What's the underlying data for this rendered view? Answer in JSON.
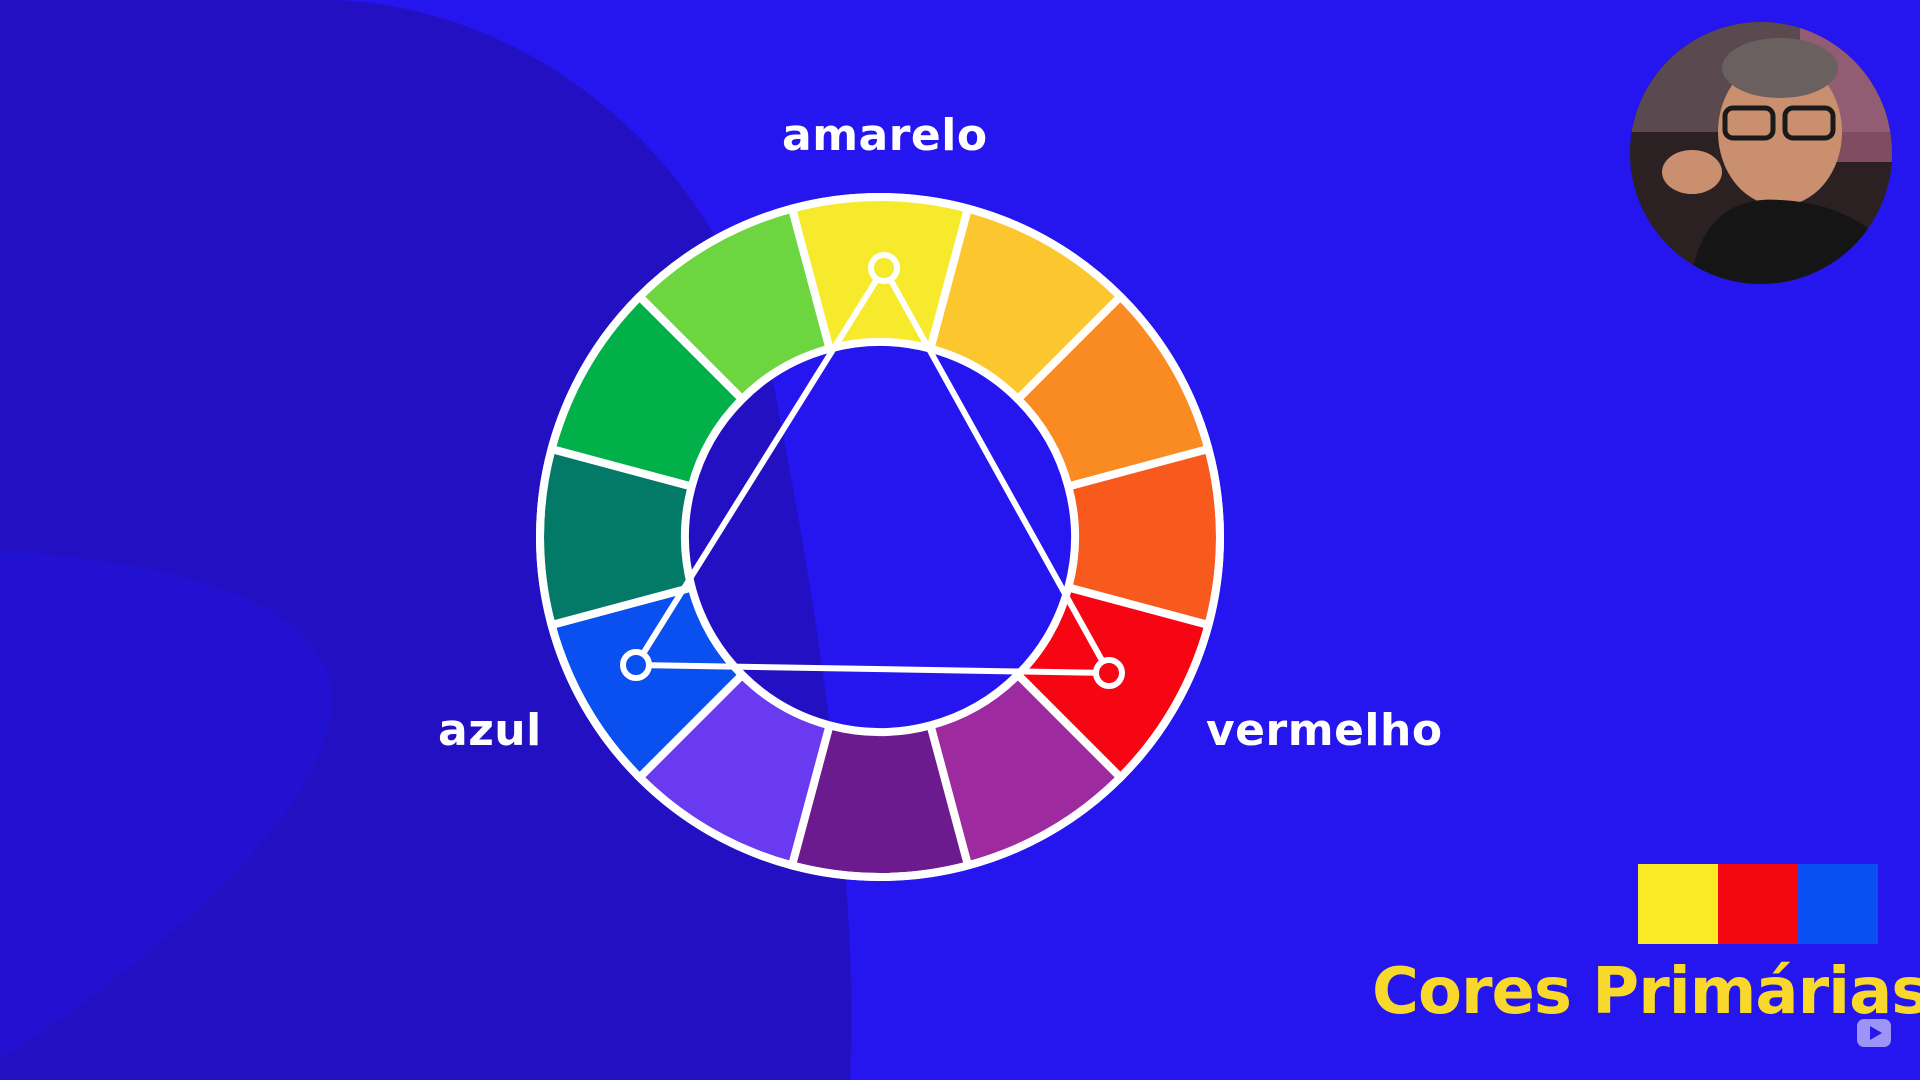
{
  "diagram": {
    "labels": {
      "yellow": "amarelo",
      "red": "vermelho",
      "blue": "azul"
    },
    "wheel_colors": [
      "#f7e92c",
      "#fbc62e",
      "#fa8a22",
      "#f75a1c",
      "#f80513",
      "#9e2aa0",
      "#6c1b8e",
      "#6a3af0",
      "#0a50f0",
      "#037a68",
      "#02b04a",
      "#6dd540"
    ],
    "triangle_vertices": [
      "yellow",
      "red",
      "blue"
    ]
  },
  "subtitle": "Cores Primárias",
  "swatches": [
    "#fbe925",
    "#f20710",
    "#0a4ff2"
  ],
  "colors": {
    "background": "#2515ee",
    "background_shape": "#2310c2",
    "title_accent": "#f8d82a"
  },
  "icons": {
    "webcam": "presenter-webcam",
    "corner": "youtube-play-icon"
  }
}
